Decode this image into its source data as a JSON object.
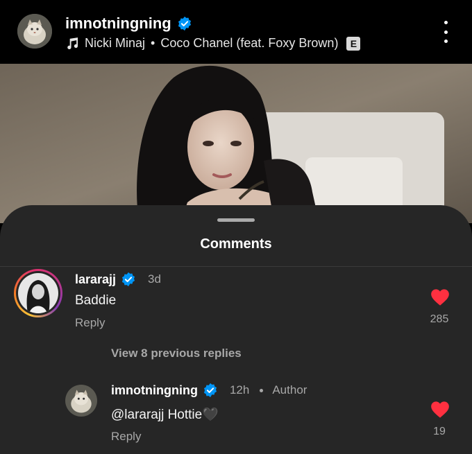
{
  "post": {
    "username": "imnotningning",
    "music_artist": "Nicki Minaj",
    "music_separator": "•",
    "music_title": "Coco Chanel (feat. Foxy Brown)",
    "explicit_badge": "E"
  },
  "sheet": {
    "title": "Comments"
  },
  "comments": [
    {
      "username": "lararajj",
      "time": "3d",
      "text": "Baddie",
      "reply_label": "Reply",
      "likes": "285"
    }
  ],
  "view_replies": "View 8 previous replies",
  "replies": [
    {
      "username": "imnotningning",
      "time": "12h",
      "author_label": "Author",
      "text": "@lararajj Hottie🖤",
      "reply_label": "Reply",
      "likes": "19"
    }
  ],
  "colors": {
    "verified": "#0095f6",
    "heart": "#ff3040",
    "sheet_bg": "#262626"
  },
  "icons": {
    "verified": "verified-badge-icon",
    "music": "music-note-icon",
    "more": "more-vertical-icon",
    "heart": "heart-icon"
  }
}
